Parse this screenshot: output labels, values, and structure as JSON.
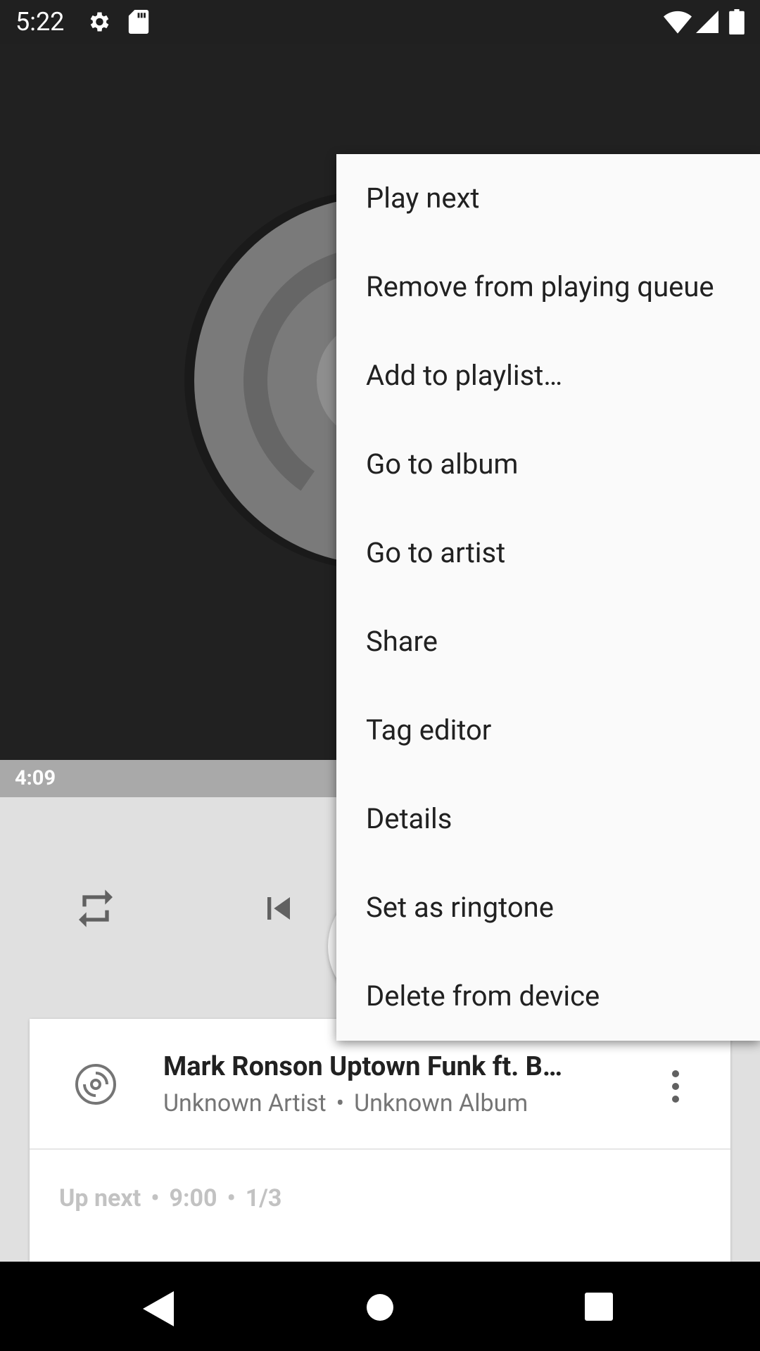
{
  "status_bar": {
    "time": "5:22"
  },
  "player": {
    "elapsed": "4:09"
  },
  "menu": {
    "items": [
      "Play next",
      "Remove from playing queue",
      "Add to playlist…",
      "Go to album",
      "Go to artist",
      "Share",
      "Tag editor",
      "Details",
      "Set as ringtone",
      "Delete from device"
    ]
  },
  "queue": {
    "title": "Mark Ronson  Uptown Funk ft. B…",
    "artist": "Unknown Artist",
    "album": "Unknown Album",
    "separator": "•",
    "upnext_label": "Up next",
    "upnext_duration": "9:00",
    "upnext_position": "1/3"
  }
}
